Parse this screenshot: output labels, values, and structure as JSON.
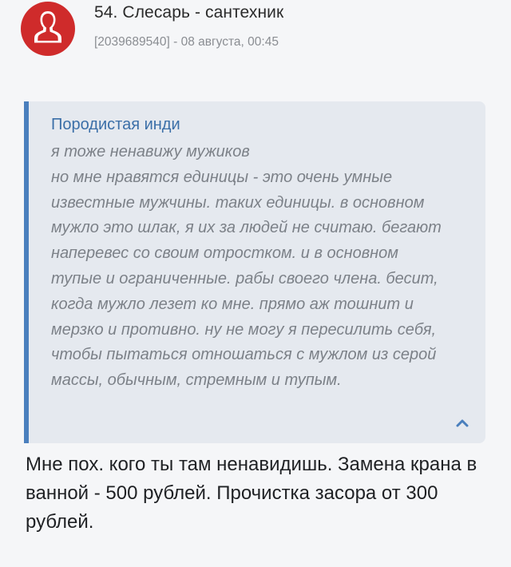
{
  "post": {
    "author": "54. Слесарь - сантехник",
    "user_id": "[2039689540]",
    "date_separator": " - ",
    "date": "08 августа, 00:45",
    "avatar_icon": "user-silhouette-icon",
    "avatar_color": "#cf2b2b"
  },
  "quote": {
    "author": "Породистая инди",
    "text": "я тоже ненавижу мужиков\nно мне нравятся единицы - это очень умные известные мужчины. таких единицы. в основном мужло это шлак, я их за людей не считаю. бегают наперевес со своим отростком. и в основном тупые и ограниченные. рабы своего члена. бесит, когда мужло лезет ко мне. прямо аж тошнит и мерзко и противно. ну не могу я пересилить себя, чтобы пытаться отношаться с мужлом из серой массы, обычным, стремным и тупым.",
    "collapse_icon": "chevron-up-icon",
    "accent_color": "#4a7fbd"
  },
  "reply": {
    "text": "Мне пох. кого ты там ненавидишь. Замена крана в ванной - 500 рублей. Прочистка засора от 300 рублей."
  }
}
